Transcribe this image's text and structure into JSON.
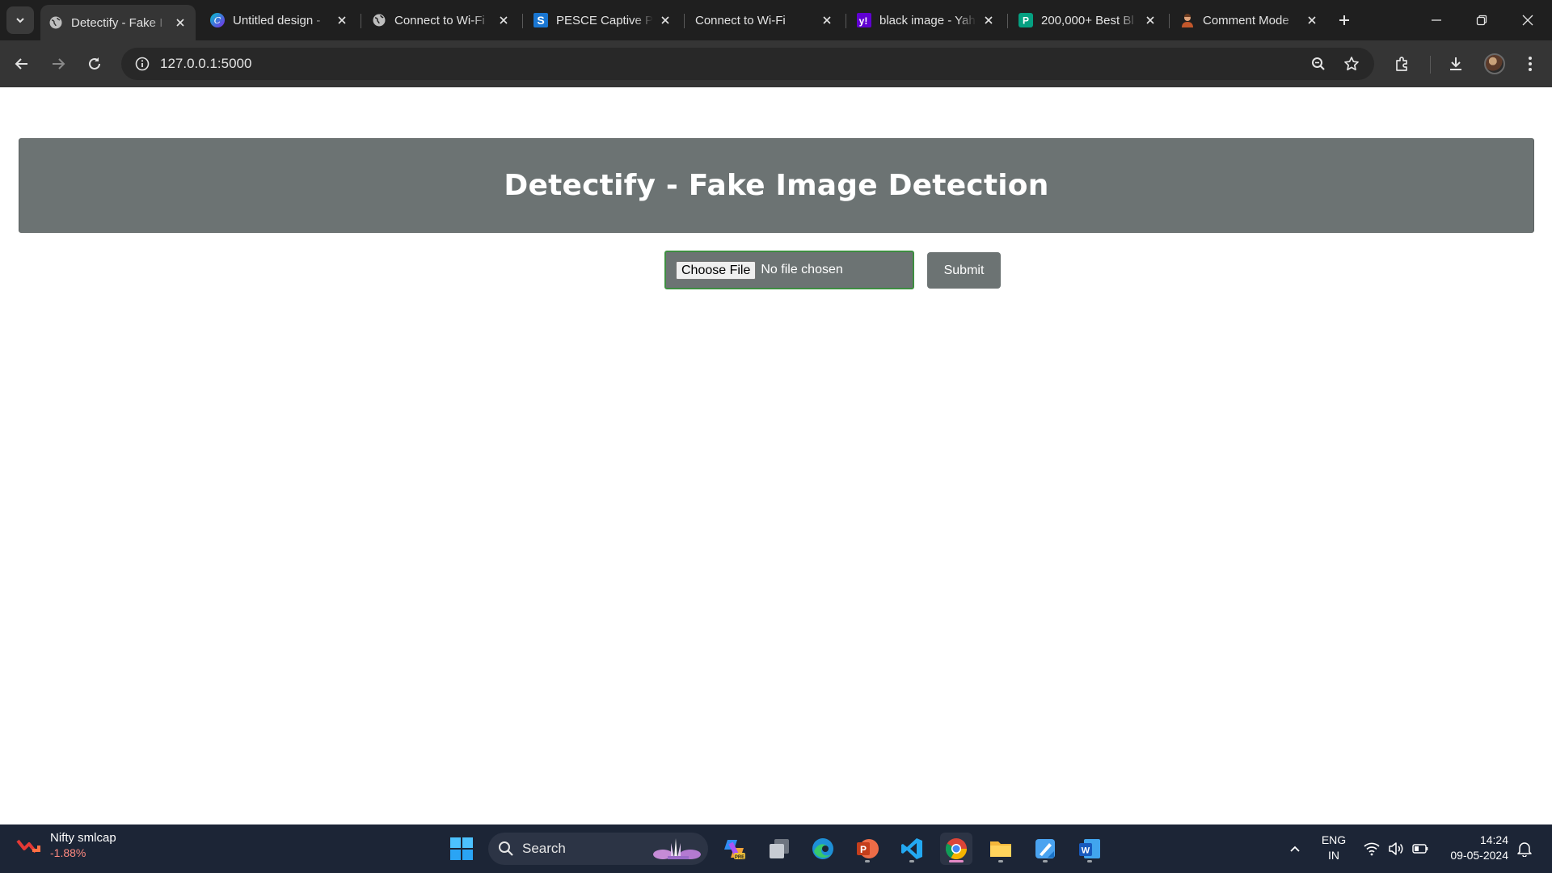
{
  "browser": {
    "tabs": [
      {
        "title": "Detectify - Fake I",
        "favicon": "globe-icon",
        "active": true
      },
      {
        "title": "Untitled design -",
        "favicon": "canva-icon",
        "active": false
      },
      {
        "title": "Connect to Wi-Fi",
        "favicon": "globe-icon",
        "active": false
      },
      {
        "title": "PESCE Captive Po",
        "favicon": "s-logo-icon",
        "active": false
      },
      {
        "title": "Connect to Wi-Fi",
        "favicon": "none",
        "active": false
      },
      {
        "title": "black image - Yah",
        "favicon": "yahoo-icon",
        "active": false
      },
      {
        "title": "200,000+ Best Bl",
        "favicon": "p-logo-icon",
        "active": false
      },
      {
        "title": "Comment Mode",
        "favicon": "person-avatar-icon",
        "active": false
      }
    ],
    "url": "127.0.0.1:5000",
    "colors": {
      "tabstrip": "#1f1f1f",
      "toolbar": "#353535",
      "omnibox": "#282828"
    }
  },
  "page": {
    "title": "Detectify - Fake Image Detection",
    "file_input": {
      "button_label": "Choose File",
      "status": "No file chosen"
    },
    "submit_label": "Submit",
    "colors": {
      "header_bg": "#6c7373",
      "file_border": "#3e8e41"
    }
  },
  "taskbar": {
    "widget": {
      "title": "Nifty smlcap",
      "change": "-1.88%"
    },
    "search_label": "Search",
    "apps": [
      "windows-start-icon",
      "copilot-icon",
      "task-view-icon",
      "edge-icon",
      "powerpoint-icon",
      "vscode-icon",
      "chrome-icon",
      "file-explorer-icon",
      "paint-icon",
      "word-icon"
    ],
    "language": {
      "line1": "ENG",
      "line2": "IN"
    },
    "clock": {
      "time": "14:24",
      "date": "09-05-2024"
    }
  }
}
